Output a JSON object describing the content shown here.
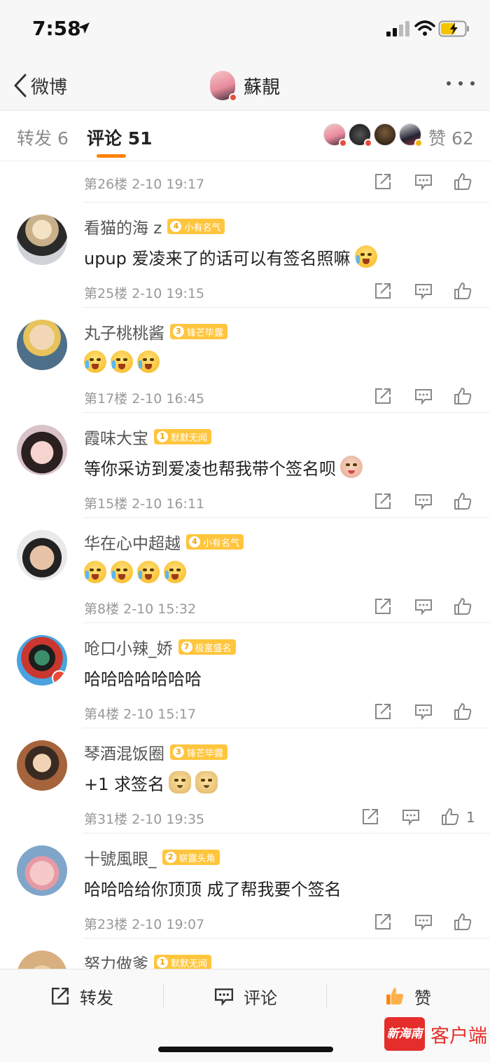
{
  "status_bar": {
    "time": "7:58"
  },
  "nav": {
    "back_label": "微博",
    "title": "蘇靚"
  },
  "tabs": {
    "repost": "转发 6",
    "comments": "评论 51",
    "likes": "赞 62"
  },
  "top_item": {
    "meta": "第26楼 2-10 19:17"
  },
  "comments": [
    {
      "name": "看猫的海 z",
      "badge_level": "4",
      "badge_text": "小有名气",
      "text": "upup 爱凌来了的话可以有签名照嘛",
      "emojis": [
        "cry"
      ],
      "meta": "第25楼 2-10 19:15",
      "likes": ""
    },
    {
      "name": "丸子桃桃酱",
      "badge_level": "3",
      "badge_text": "锋芒毕露",
      "text": "",
      "emojis": [
        "cry",
        "cry",
        "cry"
      ],
      "meta": "第17楼 2-10 16:45",
      "likes": ""
    },
    {
      "name": "霞味大宝",
      "badge_level": "1",
      "badge_text": "默默无闻",
      "text": "等你采访到爱凌也帮我带个签名呗",
      "emojis": [
        "pig"
      ],
      "meta": "第15楼 2-10 16:11",
      "likes": ""
    },
    {
      "name": "华在心中超越",
      "badge_level": "4",
      "badge_text": "小有名气",
      "text": "",
      "emojis": [
        "cry",
        "cry",
        "cry",
        "cry"
      ],
      "meta": "第8楼 2-10 15:32",
      "likes": ""
    },
    {
      "name": "呛口小辣_娇",
      "badge_level": "7",
      "badge_text": "极富盛名",
      "text": "哈哈哈哈哈哈哈",
      "emojis": [],
      "meta": "第4楼 2-10 15:17",
      "likes": ""
    },
    {
      "name": "琴酒混饭圈",
      "badge_level": "3",
      "badge_text": "锋芒毕露",
      "text": "+1 求签名",
      "emojis": [
        "dog",
        "dog"
      ],
      "meta": "第31楼 2-10 19:35",
      "likes": "1"
    },
    {
      "name": "十號風眼_",
      "badge_level": "2",
      "badge_text": "崭露头角",
      "text": "哈哈哈给你顶顶 成了帮我要个签名",
      "emojis": [],
      "meta": "第23楼 2-10 19:07",
      "likes": ""
    },
    {
      "name": "努力做爹",
      "badge_level": "1",
      "badge_text": "默默无闻",
      "text": "",
      "emojis": [],
      "meta": "",
      "likes": ""
    }
  ],
  "bottom_bar": {
    "repost": "转发",
    "comment": "评论",
    "like": "赞"
  },
  "watermark": {
    "logo": "新海南",
    "text": "客户端"
  },
  "colors": {
    "accent": "#ff8200",
    "badge": "#ffc53d",
    "watermark": "#e52e2b"
  }
}
